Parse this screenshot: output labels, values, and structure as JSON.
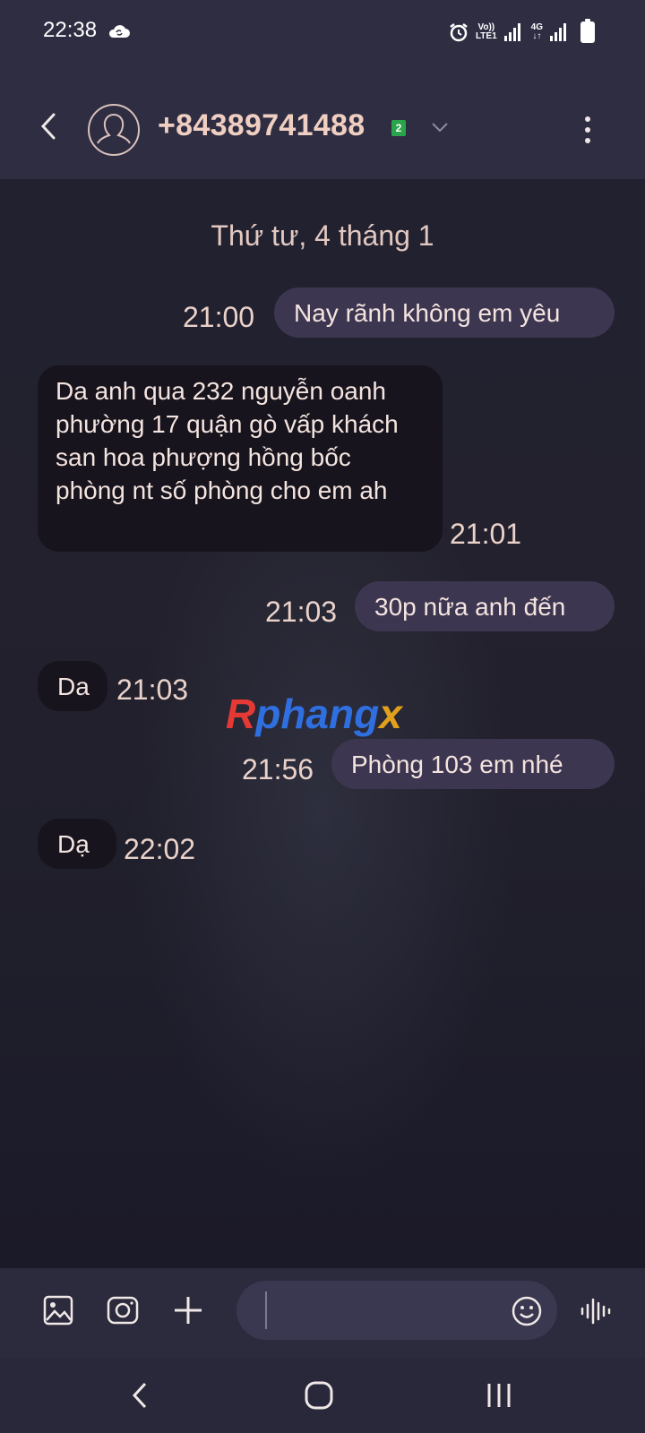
{
  "status_bar": {
    "time": "22:38",
    "net1_top": "Vo))",
    "net1_bottom": "LTE1",
    "net2": "4G"
  },
  "header": {
    "contact_number": "+84389741488",
    "sim_badge": "2"
  },
  "conversation": {
    "date_separator": "Thứ tư, 4 tháng 1",
    "messages": [
      {
        "direction": "sent",
        "text": "Nay rãnh không em yêu",
        "time": "21:00"
      },
      {
        "direction": "received",
        "text": "Da anh qua 232 nguyễn oanh phường 17  quận gò vấp khách san hoa phượng hồng bốc phòng nt số phòng cho em ah",
        "time": "21:01"
      },
      {
        "direction": "sent",
        "text": "30p nữa anh đến",
        "time": "21:03"
      },
      {
        "direction": "received",
        "text": "Da",
        "time": "21:03"
      },
      {
        "direction": "sent",
        "text": "Phòng 103 em nhé",
        "time": "21:56"
      },
      {
        "direction": "received",
        "text": "Dạ",
        "time": "22:02"
      }
    ]
  },
  "watermark": {
    "part1": "R",
    "part2": "phang",
    "part3": "x"
  },
  "colors": {
    "bar_bg": "#2f2d42",
    "sent_bubble": "#3d3650",
    "received_bubble": "#17141d",
    "contact_text": "#f0cfc2",
    "sim_badge": "#2aa54b"
  },
  "icons": {
    "composer": [
      "gallery-icon",
      "camera-icon",
      "plus-icon",
      "emoji-icon",
      "voice-icon"
    ],
    "navigation": [
      "back-icon",
      "home-icon",
      "recents-icon"
    ]
  }
}
